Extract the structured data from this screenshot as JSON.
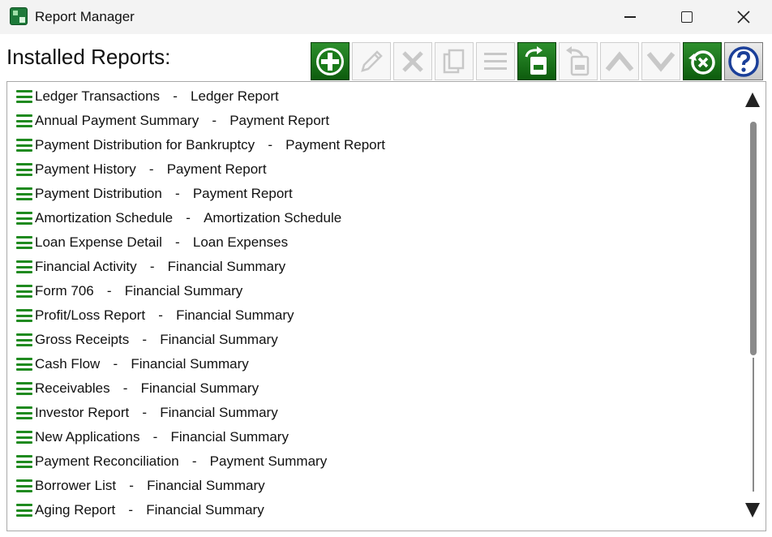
{
  "window": {
    "title": "Report Manager",
    "minimize_icon": "minimize-icon",
    "maximize_icon": "maximize-icon",
    "close_icon": "close-icon"
  },
  "header": {
    "label": "Installed Reports:"
  },
  "toolbar": {
    "buttons": [
      {
        "name": "add",
        "icon": "plus-circle-icon",
        "enabled": true
      },
      {
        "name": "edit",
        "icon": "pencil-icon",
        "enabled": false
      },
      {
        "name": "delete",
        "icon": "x-icon",
        "enabled": false
      },
      {
        "name": "copy",
        "icon": "copy-icon",
        "enabled": false
      },
      {
        "name": "properties",
        "icon": "lines-icon",
        "enabled": false
      },
      {
        "name": "import",
        "icon": "import-arrow-icon",
        "enabled": true
      },
      {
        "name": "export",
        "icon": "export-arrow-icon",
        "enabled": false
      },
      {
        "name": "move-up",
        "icon": "chevron-up-icon",
        "enabled": false
      },
      {
        "name": "move-down",
        "icon": "chevron-down-icon",
        "enabled": false
      },
      {
        "name": "restore-defaults",
        "icon": "restore-icon",
        "enabled": true
      },
      {
        "name": "help",
        "icon": "question-mark-icon",
        "enabled": true
      }
    ],
    "accent": "#1a7a1a",
    "disabled_color": "#c8c8c8",
    "help_color": "#1b3f99"
  },
  "reports": [
    {
      "name": "Ledger Transactions",
      "type": "Ledger Report"
    },
    {
      "name": "Annual Payment Summary",
      "type": "Payment Report"
    },
    {
      "name": "Payment Distribution for Bankruptcy",
      "type": "Payment Report"
    },
    {
      "name": "Payment History",
      "type": "Payment Report"
    },
    {
      "name": "Payment Distribution",
      "type": "Payment Report"
    },
    {
      "name": "Amortization Schedule",
      "type": "Amortization Schedule"
    },
    {
      "name": "Loan Expense Detail",
      "type": "Loan Expenses"
    },
    {
      "name": "Financial Activity",
      "type": "Financial Summary"
    },
    {
      "name": "Form 706",
      "type": "Financial Summary"
    },
    {
      "name": "Profit/Loss Report",
      "type": "Financial Summary"
    },
    {
      "name": "Gross Receipts",
      "type": "Financial Summary"
    },
    {
      "name": "Cash Flow",
      "type": "Financial Summary"
    },
    {
      "name": "Receivables",
      "type": "Financial Summary"
    },
    {
      "name": "Investor Report",
      "type": "Financial Summary"
    },
    {
      "name": "New Applications",
      "type": "Financial Summary"
    },
    {
      "name": "Payment Reconciliation",
      "type": "Payment Summary"
    },
    {
      "name": "Borrower List",
      "type": "Financial Summary"
    },
    {
      "name": "Aging Report",
      "type": "Financial Summary"
    }
  ],
  "separator": "-",
  "list_icon": "drag-handle-icon",
  "scrollbar": {
    "up_icon": "scroll-up-arrow-icon",
    "down_icon": "scroll-down-arrow-icon"
  }
}
